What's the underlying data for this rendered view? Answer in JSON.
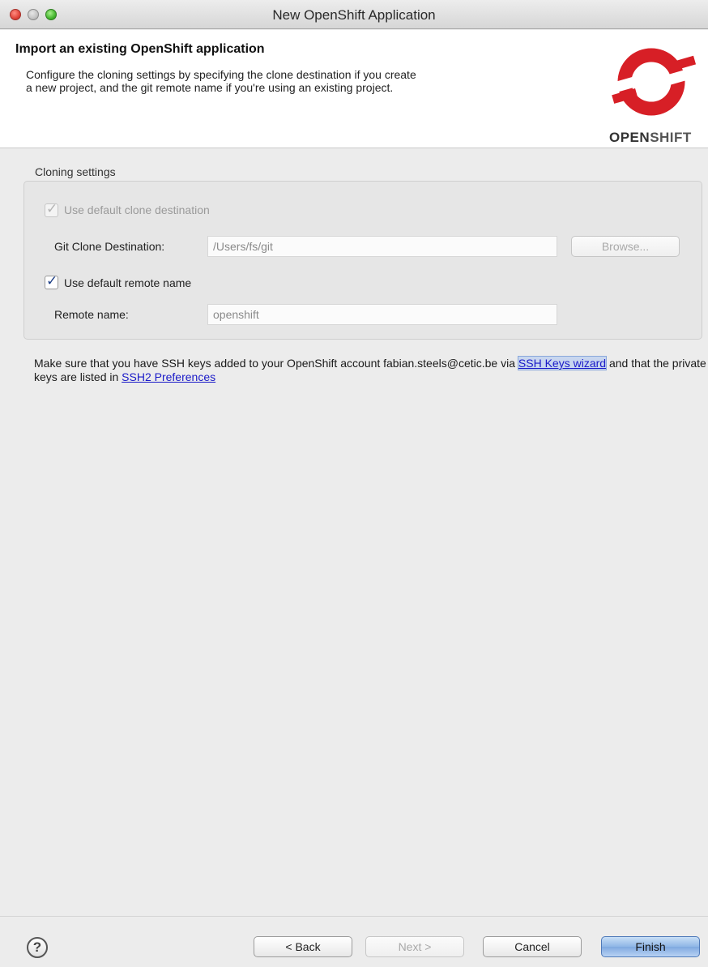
{
  "window": {
    "title": "New OpenShift Application"
  },
  "header": {
    "title": "Import an existing OpenShift application",
    "description": "Configure the cloning settings by specifying the clone destination if you create a new project, and the git remote name if you're using an existing project.",
    "logo_text_bold": "OPEN",
    "logo_text_rest": "SHIFT"
  },
  "cloning": {
    "group_label": "Cloning settings",
    "use_default_destination_label": "Use default clone destination",
    "use_default_destination_checked": true,
    "use_default_destination_enabled": false,
    "destination_label": "Git Clone Destination:",
    "destination_value": "/Users/fs/git",
    "browse_label": "Browse...",
    "use_default_remote_label": "Use default remote name",
    "use_default_remote_checked": true,
    "remote_name_label": "Remote name:",
    "remote_name_value": "openshift"
  },
  "info": {
    "text_before": "Make sure that you have SSH keys added to your OpenShift account fabian.steels@cetic.be via ",
    "ssh_keys_link_part1": "SSH Keys",
    "ssh_keys_link_part2": "wizard",
    "text_middle": " and that the private keys are listed in ",
    "ssh2_prefs_link": "SSH2 Preferences"
  },
  "footer": {
    "help_label": "?",
    "back_label": "< Back",
    "next_label": "Next >",
    "cancel_label": "Cancel",
    "finish_label": "Finish"
  },
  "colors": {
    "logo_red": "#d71f26",
    "link_blue": "#1a1ac8",
    "default_button_blue": "#8fb6e6"
  }
}
